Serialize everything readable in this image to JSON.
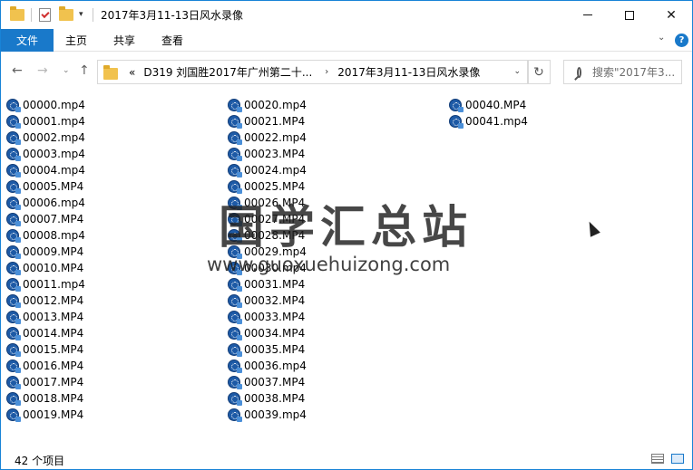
{
  "window": {
    "title": "2017年3月11-13日风水录像",
    "minimize_glyph": "—",
    "maximize_glyph": "☐",
    "close_glyph": "✕"
  },
  "quick_access": {
    "dropdown_glyph": "▾"
  },
  "ribbon": {
    "file_tab": "文件",
    "tabs": [
      "主页",
      "共享",
      "查看"
    ],
    "expand_glyph": "⌄",
    "help_glyph": "?"
  },
  "nav": {
    "back_glyph": "←",
    "forward_glyph": "→",
    "recent_glyph": "⌄",
    "up_glyph": "↑",
    "refresh_glyph": "↻"
  },
  "address": {
    "overflow": "«",
    "segment1": "D319 刘国胜2017年广州第二十...",
    "separator": "›",
    "segment2": "2017年3月11-13日风水录像",
    "dropdown_glyph": "⌄"
  },
  "search": {
    "placeholder": "搜索\"2017年3..."
  },
  "files": {
    "column1": [
      "00000.mp4",
      "00001.mp4",
      "00002.mp4",
      "00003.mp4",
      "00004.mp4",
      "00005.MP4",
      "00006.mp4",
      "00007.MP4",
      "00008.mp4",
      "00009.MP4",
      "00010.MP4",
      "00011.mp4",
      "00012.MP4",
      "00013.MP4",
      "00014.MP4",
      "00015.MP4",
      "00016.MP4",
      "00017.MP4",
      "00018.MP4",
      "00019.MP4"
    ],
    "column2": [
      "00020.mp4",
      "00021.MP4",
      "00022.mp4",
      "00023.MP4",
      "00024.mp4",
      "00025.MP4",
      "00026.MP4",
      "00027.MP4",
      "00028.MP4",
      "00029.mp4",
      "00030.mp4",
      "00031.MP4",
      "00032.MP4",
      "00033.MP4",
      "00034.MP4",
      "00035.MP4",
      "00036.mp4",
      "00037.MP4",
      "00038.MP4",
      "00039.mp4"
    ],
    "column3": [
      "00040.MP4",
      "00041.mp4"
    ],
    "icon": "video-file-icon"
  },
  "watermark": {
    "chinese": "国学汇总站",
    "url": "www.guoxuehuizong.com"
  },
  "status": {
    "item_count": "42 个项目"
  },
  "colors": {
    "accent": "#1979ca",
    "border": "#1883d7"
  }
}
